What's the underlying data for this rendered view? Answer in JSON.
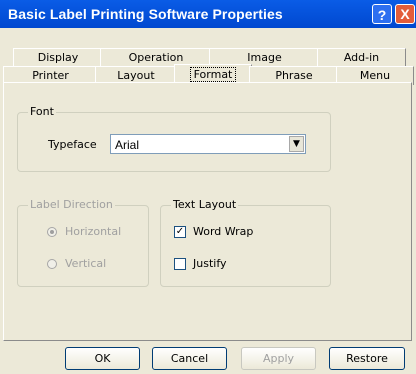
{
  "window": {
    "title": "Basic Label Printing Software Properties"
  },
  "titlebar": {
    "help_label": "?",
    "close_label": "X"
  },
  "tabs": {
    "row1": [
      "Display",
      "Operation",
      "Image",
      "Add-in"
    ],
    "row2": [
      "Printer",
      "Layout",
      "Format",
      "Phrase",
      "Menu"
    ],
    "active": "Format"
  },
  "font_group": {
    "label": "Font",
    "typeface_label": "Typeface",
    "typeface_value": "Arial"
  },
  "label_direction": {
    "label": "Label Direction",
    "horizontal": "Horizontal",
    "vertical": "Vertical",
    "selected": "Horizontal"
  },
  "text_layout": {
    "label": "Text Layout",
    "word_wrap": "Word Wrap",
    "justify": "Justify",
    "word_wrap_checked": true,
    "justify_checked": false
  },
  "buttons": {
    "ok": "OK",
    "cancel": "Cancel",
    "apply": "Apply",
    "restore": "Restore"
  }
}
